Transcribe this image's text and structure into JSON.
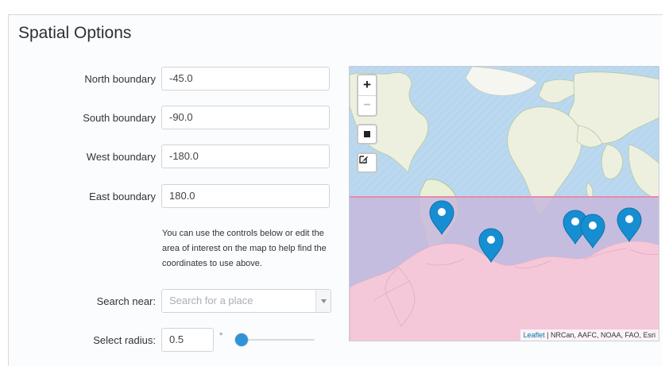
{
  "panel": {
    "title": "Spatial Options"
  },
  "boundaries": [
    {
      "label": "North boundary",
      "value": "-45.0"
    },
    {
      "label": "South boundary",
      "value": "-90.0"
    },
    {
      "label": "West boundary",
      "value": "-180.0"
    },
    {
      "label": "East boundary",
      "value": "180.0"
    }
  ],
  "help_text": "You can use the controls below or edit the area of interest on the map to help find the coordinates to use above.",
  "search": {
    "label": "Search near:",
    "placeholder": "Search for a place",
    "dropdown_icon": "chevron-down-icon"
  },
  "radius": {
    "label": "Select radius:",
    "value": "0.5",
    "unit": "°",
    "slider_fraction": 0.08
  },
  "map": {
    "zoom_in_label": "+",
    "zoom_out_label": "−",
    "draw_rectangle_icon": "square-icon",
    "edit_icon": "edit-icon",
    "attribution_link": "Leaflet",
    "attribution_text": " | NRCan, AAFC, NOAA, FAO, Esri",
    "selection_colors": {
      "fill": "#c6b8dc",
      "border": "#e989b1",
      "ocean": "#b8d7ef",
      "land": "#edf0df"
    },
    "markers": [
      {
        "name": "map-marker-1",
        "icon": "map-marker-icon"
      },
      {
        "name": "map-marker-2",
        "icon": "map-marker-icon"
      },
      {
        "name": "map-marker-3",
        "icon": "map-marker-icon"
      },
      {
        "name": "map-marker-4",
        "icon": "map-marker-icon"
      },
      {
        "name": "map-marker-5",
        "icon": "map-marker-icon"
      }
    ]
  }
}
